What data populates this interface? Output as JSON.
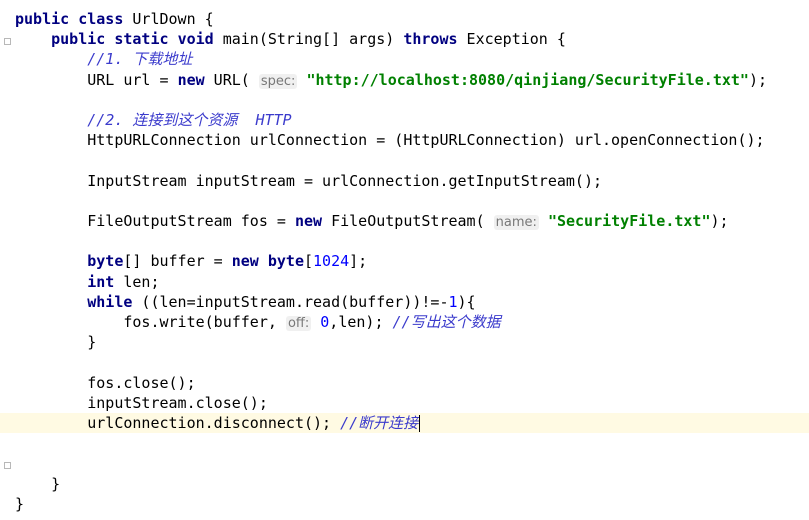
{
  "editor": {
    "lines": [
      {
        "tokens": [
          {
            "t": "kw",
            "v": "public"
          },
          {
            "t": "plain",
            "v": " "
          },
          {
            "t": "kw",
            "v": "class"
          },
          {
            "t": "plain",
            "v": " UrlDown {"
          }
        ]
      },
      {
        "tokens": [
          {
            "t": "plain",
            "v": "    "
          },
          {
            "t": "kw",
            "v": "public"
          },
          {
            "t": "plain",
            "v": " "
          },
          {
            "t": "kw",
            "v": "static"
          },
          {
            "t": "plain",
            "v": " "
          },
          {
            "t": "kw",
            "v": "void"
          },
          {
            "t": "plain",
            "v": " main(String[] args) "
          },
          {
            "t": "kw",
            "v": "throws"
          },
          {
            "t": "plain",
            "v": " Exception {"
          }
        ]
      },
      {
        "tokens": [
          {
            "t": "plain",
            "v": "        "
          },
          {
            "t": "cmt-blue",
            "v": "//1. 下载地址"
          }
        ]
      },
      {
        "tokens": [
          {
            "t": "plain",
            "v": "        URL url = "
          },
          {
            "t": "kw",
            "v": "new"
          },
          {
            "t": "plain",
            "v": " URL( "
          },
          {
            "t": "hint",
            "v": "spec:"
          },
          {
            "t": "plain",
            "v": " "
          },
          {
            "t": "str",
            "v": "\"http://localhost:8080/qinjiang/SecurityFile.txt\""
          },
          {
            "t": "plain",
            "v": ");"
          }
        ]
      },
      {
        "tokens": []
      },
      {
        "tokens": [
          {
            "t": "plain",
            "v": "        "
          },
          {
            "t": "cmt-blue",
            "v": "//2. 连接到这个资源  HTTP"
          }
        ]
      },
      {
        "tokens": [
          {
            "t": "plain",
            "v": "        HttpURLConnection urlConnection = (HttpURLConnection) url.openConnection();"
          }
        ]
      },
      {
        "tokens": []
      },
      {
        "tokens": [
          {
            "t": "plain",
            "v": "        InputStream inputStream = urlConnection.getInputStream();"
          }
        ]
      },
      {
        "tokens": []
      },
      {
        "tokens": [
          {
            "t": "plain",
            "v": "        FileOutputStream fos = "
          },
          {
            "t": "kw",
            "v": "new"
          },
          {
            "t": "plain",
            "v": " FileOutputStream( "
          },
          {
            "t": "hint",
            "v": "name:"
          },
          {
            "t": "plain",
            "v": " "
          },
          {
            "t": "str",
            "v": "\"SecurityFile.txt\""
          },
          {
            "t": "plain",
            "v": ");"
          }
        ]
      },
      {
        "tokens": []
      },
      {
        "tokens": [
          {
            "t": "plain",
            "v": "        "
          },
          {
            "t": "kw",
            "v": "byte"
          },
          {
            "t": "plain",
            "v": "[] buffer = "
          },
          {
            "t": "kw",
            "v": "new"
          },
          {
            "t": "plain",
            "v": " "
          },
          {
            "t": "kw",
            "v": "byte"
          },
          {
            "t": "plain",
            "v": "["
          },
          {
            "t": "num",
            "v": "1024"
          },
          {
            "t": "plain",
            "v": "];"
          }
        ]
      },
      {
        "tokens": [
          {
            "t": "plain",
            "v": "        "
          },
          {
            "t": "kw",
            "v": "int"
          },
          {
            "t": "plain",
            "v": " len;"
          }
        ]
      },
      {
        "tokens": [
          {
            "t": "plain",
            "v": "        "
          },
          {
            "t": "kw",
            "v": "while"
          },
          {
            "t": "plain",
            "v": " ((len=inputStream.read(buffer))!=-"
          },
          {
            "t": "num",
            "v": "1"
          },
          {
            "t": "plain",
            "v": "){"
          }
        ]
      },
      {
        "tokens": [
          {
            "t": "plain",
            "v": "            fos.write(buffer, "
          },
          {
            "t": "hint",
            "v": "off:"
          },
          {
            "t": "plain",
            "v": " "
          },
          {
            "t": "num",
            "v": "0"
          },
          {
            "t": "plain",
            "v": ",len); "
          },
          {
            "t": "cmt-blue",
            "v": "//写出这个数据"
          }
        ]
      },
      {
        "tokens": [
          {
            "t": "plain",
            "v": "        }"
          }
        ]
      },
      {
        "tokens": []
      },
      {
        "tokens": [
          {
            "t": "plain",
            "v": "        fos.close();"
          }
        ]
      },
      {
        "tokens": [
          {
            "t": "plain",
            "v": "        inputStream.close();"
          }
        ]
      },
      {
        "tokens": [
          {
            "t": "plain",
            "v": "        urlConnection.disconnect(); "
          },
          {
            "t": "cmt-blue",
            "v": "//断开连接"
          }
        ],
        "current": true,
        "caret": true
      },
      {
        "tokens": []
      },
      {
        "tokens": []
      },
      {
        "tokens": [
          {
            "t": "plain",
            "v": "    }"
          }
        ]
      },
      {
        "tokens": [
          {
            "t": "plain",
            "v": "}"
          }
        ]
      }
    ]
  }
}
